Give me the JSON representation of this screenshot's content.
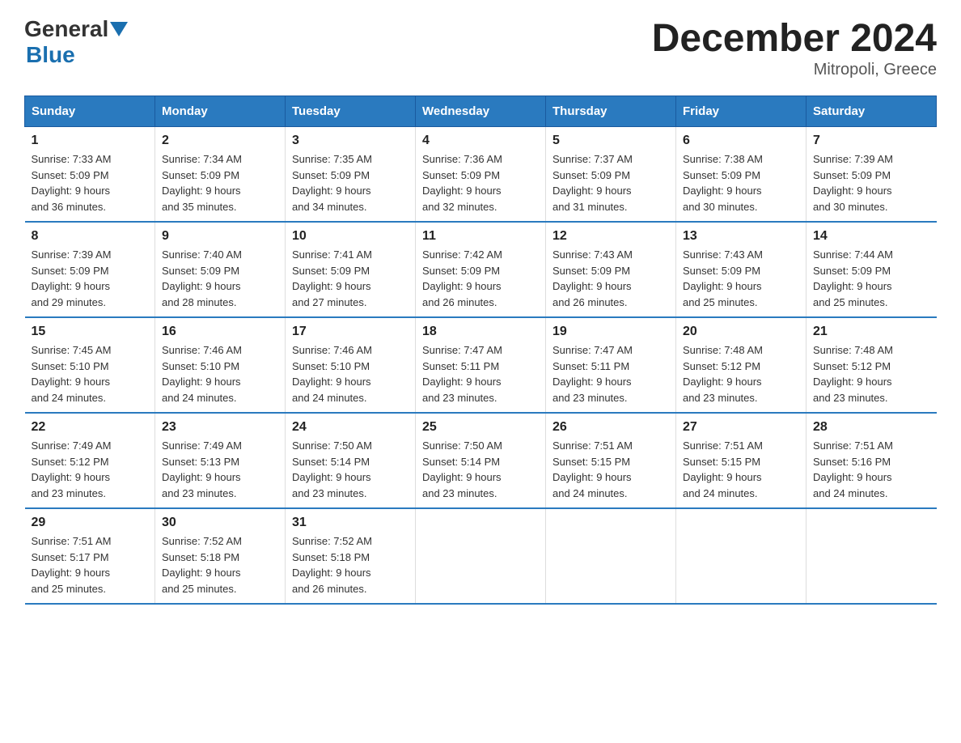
{
  "header": {
    "logo_general": "General",
    "logo_blue": "Blue",
    "title": "December 2024",
    "subtitle": "Mitropoli, Greece"
  },
  "weekdays": [
    "Sunday",
    "Monday",
    "Tuesday",
    "Wednesday",
    "Thursday",
    "Friday",
    "Saturday"
  ],
  "weeks": [
    [
      {
        "day": "1",
        "sunrise": "7:33 AM",
        "sunset": "5:09 PM",
        "daylight": "9 hours and 36 minutes."
      },
      {
        "day": "2",
        "sunrise": "7:34 AM",
        "sunset": "5:09 PM",
        "daylight": "9 hours and 35 minutes."
      },
      {
        "day": "3",
        "sunrise": "7:35 AM",
        "sunset": "5:09 PM",
        "daylight": "9 hours and 34 minutes."
      },
      {
        "day": "4",
        "sunrise": "7:36 AM",
        "sunset": "5:09 PM",
        "daylight": "9 hours and 32 minutes."
      },
      {
        "day": "5",
        "sunrise": "7:37 AM",
        "sunset": "5:09 PM",
        "daylight": "9 hours and 31 minutes."
      },
      {
        "day": "6",
        "sunrise": "7:38 AM",
        "sunset": "5:09 PM",
        "daylight": "9 hours and 30 minutes."
      },
      {
        "day": "7",
        "sunrise": "7:39 AM",
        "sunset": "5:09 PM",
        "daylight": "9 hours and 30 minutes."
      }
    ],
    [
      {
        "day": "8",
        "sunrise": "7:39 AM",
        "sunset": "5:09 PM",
        "daylight": "9 hours and 29 minutes."
      },
      {
        "day": "9",
        "sunrise": "7:40 AM",
        "sunset": "5:09 PM",
        "daylight": "9 hours and 28 minutes."
      },
      {
        "day": "10",
        "sunrise": "7:41 AM",
        "sunset": "5:09 PM",
        "daylight": "9 hours and 27 minutes."
      },
      {
        "day": "11",
        "sunrise": "7:42 AM",
        "sunset": "5:09 PM",
        "daylight": "9 hours and 26 minutes."
      },
      {
        "day": "12",
        "sunrise": "7:43 AM",
        "sunset": "5:09 PM",
        "daylight": "9 hours and 26 minutes."
      },
      {
        "day": "13",
        "sunrise": "7:43 AM",
        "sunset": "5:09 PM",
        "daylight": "9 hours and 25 minutes."
      },
      {
        "day": "14",
        "sunrise": "7:44 AM",
        "sunset": "5:09 PM",
        "daylight": "9 hours and 25 minutes."
      }
    ],
    [
      {
        "day": "15",
        "sunrise": "7:45 AM",
        "sunset": "5:10 PM",
        "daylight": "9 hours and 24 minutes."
      },
      {
        "day": "16",
        "sunrise": "7:46 AM",
        "sunset": "5:10 PM",
        "daylight": "9 hours and 24 minutes."
      },
      {
        "day": "17",
        "sunrise": "7:46 AM",
        "sunset": "5:10 PM",
        "daylight": "9 hours and 24 minutes."
      },
      {
        "day": "18",
        "sunrise": "7:47 AM",
        "sunset": "5:11 PM",
        "daylight": "9 hours and 23 minutes."
      },
      {
        "day": "19",
        "sunrise": "7:47 AM",
        "sunset": "5:11 PM",
        "daylight": "9 hours and 23 minutes."
      },
      {
        "day": "20",
        "sunrise": "7:48 AM",
        "sunset": "5:12 PM",
        "daylight": "9 hours and 23 minutes."
      },
      {
        "day": "21",
        "sunrise": "7:48 AM",
        "sunset": "5:12 PM",
        "daylight": "9 hours and 23 minutes."
      }
    ],
    [
      {
        "day": "22",
        "sunrise": "7:49 AM",
        "sunset": "5:12 PM",
        "daylight": "9 hours and 23 minutes."
      },
      {
        "day": "23",
        "sunrise": "7:49 AM",
        "sunset": "5:13 PM",
        "daylight": "9 hours and 23 minutes."
      },
      {
        "day": "24",
        "sunrise": "7:50 AM",
        "sunset": "5:14 PM",
        "daylight": "9 hours and 23 minutes."
      },
      {
        "day": "25",
        "sunrise": "7:50 AM",
        "sunset": "5:14 PM",
        "daylight": "9 hours and 23 minutes."
      },
      {
        "day": "26",
        "sunrise": "7:51 AM",
        "sunset": "5:15 PM",
        "daylight": "9 hours and 24 minutes."
      },
      {
        "day": "27",
        "sunrise": "7:51 AM",
        "sunset": "5:15 PM",
        "daylight": "9 hours and 24 minutes."
      },
      {
        "day": "28",
        "sunrise": "7:51 AM",
        "sunset": "5:16 PM",
        "daylight": "9 hours and 24 minutes."
      }
    ],
    [
      {
        "day": "29",
        "sunrise": "7:51 AM",
        "sunset": "5:17 PM",
        "daylight": "9 hours and 25 minutes."
      },
      {
        "day": "30",
        "sunrise": "7:52 AM",
        "sunset": "5:18 PM",
        "daylight": "9 hours and 25 minutes."
      },
      {
        "day": "31",
        "sunrise": "7:52 AM",
        "sunset": "5:18 PM",
        "daylight": "9 hours and 26 minutes."
      },
      null,
      null,
      null,
      null
    ]
  ],
  "labels": {
    "sunrise": "Sunrise:",
    "sunset": "Sunset:",
    "daylight": "Daylight:"
  }
}
